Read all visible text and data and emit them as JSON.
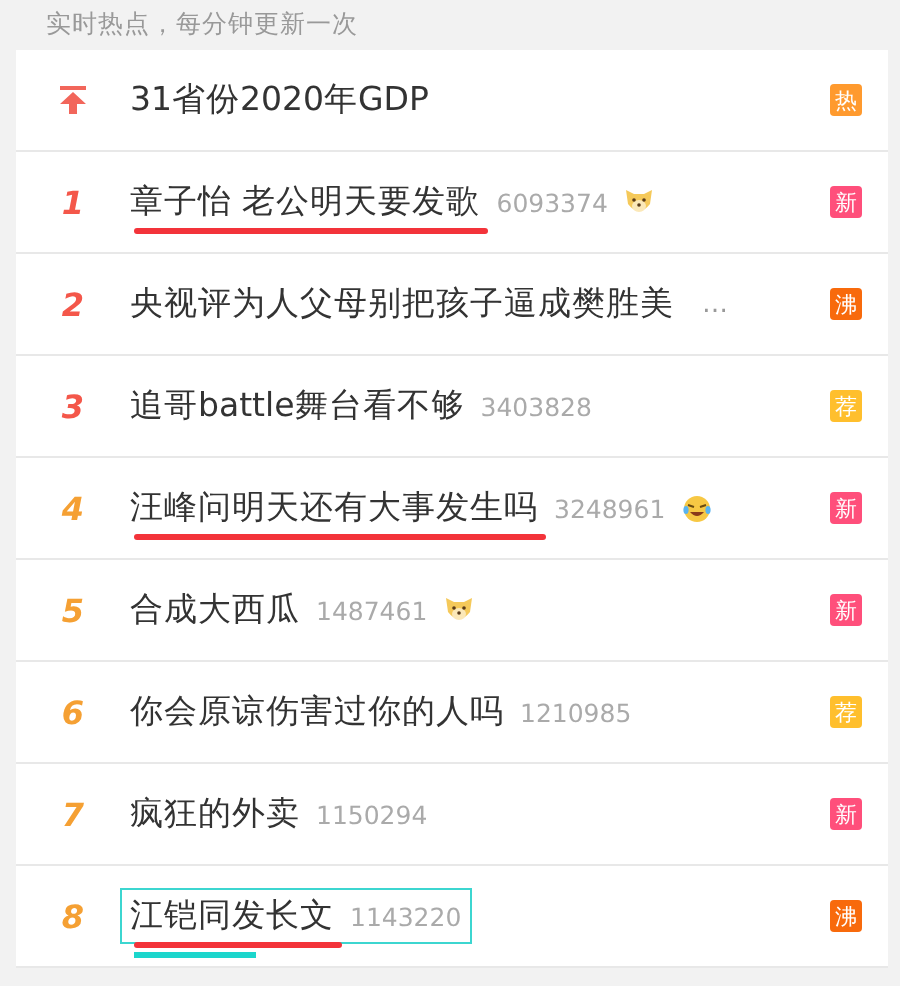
{
  "header": {
    "text": "实时热点，每分钟更新一次"
  },
  "rows": [
    {
      "kind": "pinned",
      "title": "31省份2020年GDP",
      "badge": {
        "text": "热",
        "color": "#ff9a2e"
      },
      "underlined": false,
      "boxed": false
    },
    {
      "kind": "rank",
      "rank": "1",
      "color": "#f4574a",
      "title": "章子怡 老公明天要发歌",
      "count": "6093374",
      "emoji": {
        "kind": "dog"
      },
      "badge": {
        "text": "新",
        "color": "#ff4f7b"
      },
      "underlined": true,
      "boxed": false
    },
    {
      "kind": "rank",
      "rank": "2",
      "color": "#f4574a",
      "title": "央视评为人父母别把孩子逼成樊胜美",
      "more": "…",
      "badge": {
        "text": "沸",
        "color": "#f86a0c"
      },
      "underlined": false,
      "boxed": false
    },
    {
      "kind": "rank",
      "rank": "3",
      "color": "#f4574a",
      "title": "追哥battle舞台看不够",
      "count": "3403828",
      "badge": {
        "text": "荐",
        "color": "#ffbf2d"
      },
      "underlined": false,
      "boxed": false
    },
    {
      "kind": "rank",
      "rank": "4",
      "color": "#f5a033",
      "title": "汪峰问明天还有大事发生吗",
      "count": "3248961",
      "emoji": {
        "kind": "laugh"
      },
      "badge": {
        "text": "新",
        "color": "#ff4f7b"
      },
      "underlined": true,
      "boxed": false
    },
    {
      "kind": "rank",
      "rank": "5",
      "color": "#f5a033",
      "title": "合成大西瓜",
      "count": "1487461",
      "emoji": {
        "kind": "dog"
      },
      "badge": {
        "text": "新",
        "color": "#ff4f7b"
      },
      "underlined": false,
      "boxed": false
    },
    {
      "kind": "rank",
      "rank": "6",
      "color": "#f5a033",
      "title": "你会原谅伤害过你的人吗",
      "count": "1210985",
      "badge": {
        "text": "荐",
        "color": "#ffbf2d"
      },
      "underlined": false,
      "boxed": false
    },
    {
      "kind": "rank",
      "rank": "7",
      "color": "#f5a033",
      "title": "疯狂的外卖",
      "count": "1150294",
      "badge": {
        "text": "新",
        "color": "#ff4f7b"
      },
      "underlined": false,
      "boxed": false
    },
    {
      "kind": "rank",
      "rank": "8",
      "color": "#f5a033",
      "title": "江铠同发长文",
      "count": "1143220",
      "badge": {
        "text": "沸",
        "color": "#f86a0c"
      },
      "underlined": true,
      "boxed": true
    }
  ]
}
